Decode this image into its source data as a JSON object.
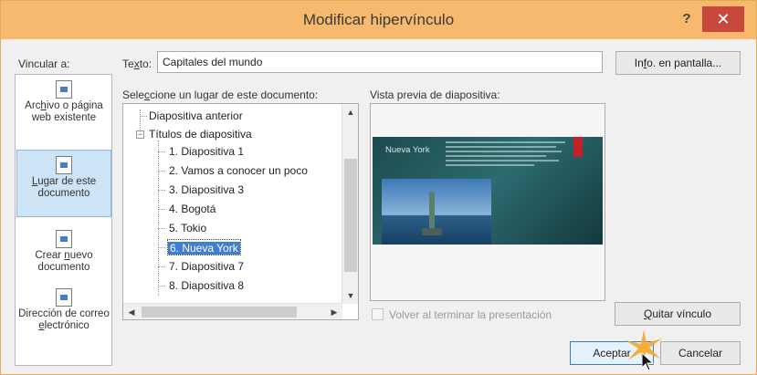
{
  "window": {
    "title": "Modificar hipervínculo",
    "help_label": "?",
    "close_label": "✕"
  },
  "link_to": {
    "label": "Vincular a:",
    "items": [
      {
        "label_pre": "Arc",
        "label_u": "h",
        "label_post": "ivo o página web existente",
        "icon": "web-page-icon",
        "selected": false
      },
      {
        "label_pre": "",
        "label_u": "L",
        "label_post": "ugar de este documento",
        "icon": "document-place-icon",
        "selected": true
      },
      {
        "label_pre": "Crear ",
        "label_u": "n",
        "label_post": "uevo documento",
        "icon": "new-document-icon",
        "selected": false
      },
      {
        "label_pre": "Dirección de correo ",
        "label_u": "e",
        "label_post": "lectrónico",
        "icon": "email-icon",
        "selected": false
      }
    ]
  },
  "text_field": {
    "label_pre": "Te",
    "label_u": "x",
    "label_post": "to:",
    "value": "Capitales del mundo"
  },
  "screentip_button": {
    "label_pre": "In",
    "label_u": "f",
    "label_post": "o. en pantalla..."
  },
  "place": {
    "label_pre": "Sele",
    "label_u": "c",
    "label_post": "cione un lugar de este documento:",
    "items": [
      {
        "label": "Diapositiva anterior"
      },
      {
        "label": "Títulos de diapositiva"
      },
      {
        "label": "1. Diapositiva 1"
      },
      {
        "label": "2. Vamos a conocer un poco"
      },
      {
        "label": "3. Diapositiva 3"
      },
      {
        "label": "4. Bogotá"
      },
      {
        "label": "5. Tokio"
      },
      {
        "label": "6. Nueva York",
        "selected": true
      },
      {
        "label": "7. Diapositiva 7"
      },
      {
        "label": "8. Diapositiva 8"
      }
    ]
  },
  "preview": {
    "label": "Vista previa de diapositiva:",
    "slide_title": "Nueva York"
  },
  "return_checkbox": {
    "label": "Volver al terminar la presentación",
    "checked": false,
    "enabled": false
  },
  "remove_link_button": {
    "label_pre": "",
    "label_u": "Q",
    "label_post": "uitar vínculo"
  },
  "accept_button": {
    "label": "Aceptar"
  },
  "cancel_button": {
    "label": "Cancelar"
  },
  "colors": {
    "titlebar": "#f7b96e",
    "close": "#c9483c",
    "selection": "#3f7ed1"
  }
}
